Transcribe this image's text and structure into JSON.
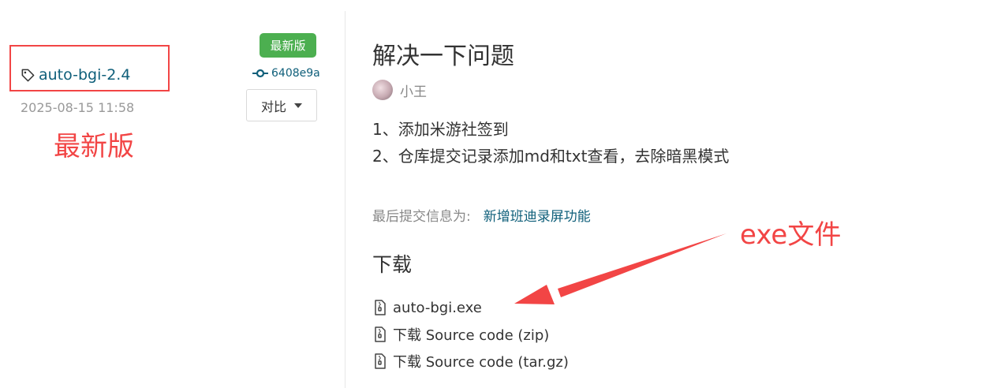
{
  "release": {
    "tag": "auto-bgi-2.4",
    "date": "2025-08-15 11:58",
    "latest_badge": "最新版",
    "commit_hash": "6408e9a",
    "compare_label": "对比"
  },
  "details": {
    "title": "解决一下问题",
    "author": "小王",
    "notes": [
      "1、添加米游社签到",
      "2、仓库提交记录添加md和txt查看，去除暗黑模式"
    ],
    "last_commit_label": "最后提交信息为:",
    "last_commit_message": "新增班迪录屏功能"
  },
  "downloads": {
    "heading": "下载",
    "items": [
      "auto-bgi.exe",
      "下载 Source code (zip)",
      "下载 Source code (tar.gz)"
    ]
  },
  "annotations": {
    "latest_label": "最新版",
    "exe_label": "exe文件",
    "color": "#f24545"
  },
  "colors": {
    "link": "#0f5f7a",
    "badge_green": "#4caf50"
  },
  "icons": [
    "tag-icon",
    "commit-icon",
    "caret-down-icon",
    "file-zip-icon"
  ]
}
